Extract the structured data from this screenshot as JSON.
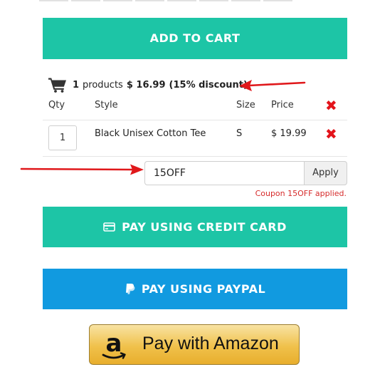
{
  "product": {
    "add_to_cart_label": "ADD TO CART"
  },
  "cart": {
    "icon": "cart-icon",
    "count": "1",
    "count_suffix": "products",
    "total": "$ 16.99",
    "discount": "(15% discount)",
    "headers": {
      "qty": "Qty",
      "style": "Style",
      "size": "Size",
      "price": "Price"
    },
    "items": [
      {
        "qty": "1",
        "style": "Black Unisex Cotton Tee",
        "size": "S",
        "price": "$ 19.99"
      }
    ],
    "remove_glyph": "✖"
  },
  "coupon": {
    "value": "15OFF",
    "apply_label": "Apply",
    "message": "Coupon 15OFF applied."
  },
  "payments": {
    "credit_label": "PAY USING CREDIT CARD",
    "credit_icon": "credit-card-icon",
    "paypal_label": "PAY USING PAYPAL",
    "paypal_icon": "paypal-icon",
    "amazon_label": "Pay with Amazon",
    "amazon_icon": "amazon-logo-icon"
  },
  "colors": {
    "accent_green": "#1dc5a6",
    "paypal_blue": "#119ae0",
    "amazon_gold": "#f0c14b",
    "remove_red": "#e3141b",
    "annotation_red": "#e0181b"
  }
}
